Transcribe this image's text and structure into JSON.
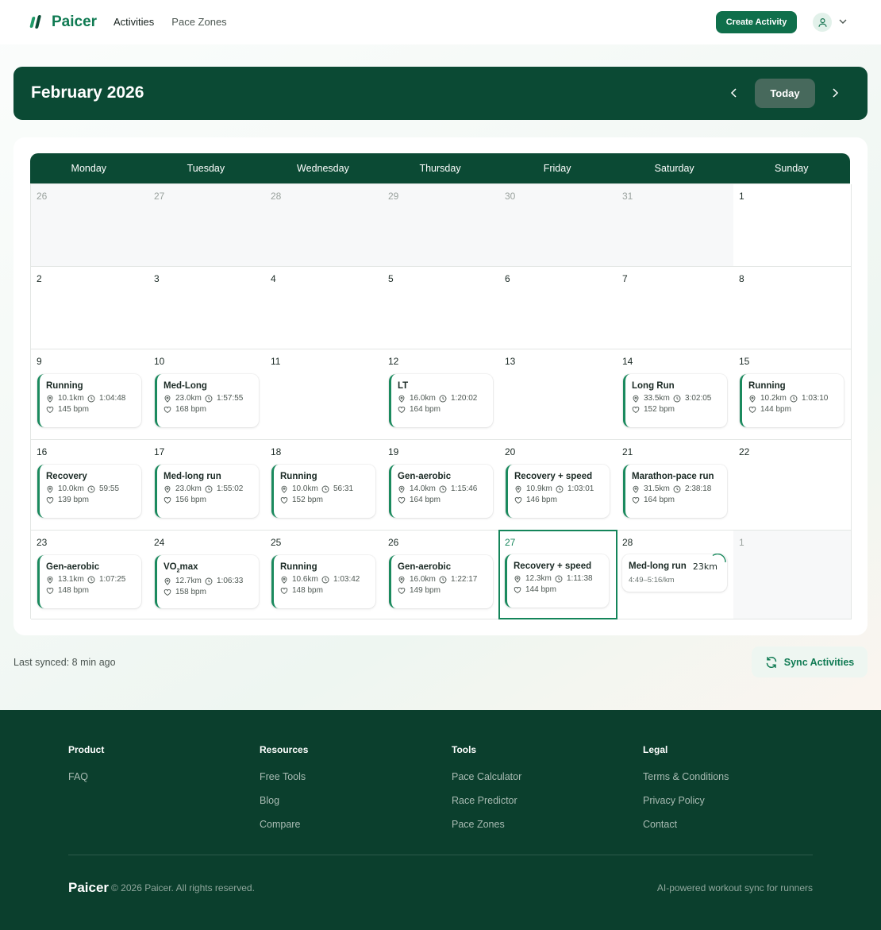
{
  "header": {
    "logo_text": "Paicer",
    "nav": [
      {
        "label": "Activities",
        "active": true
      },
      {
        "label": "Pace Zones",
        "active": false
      }
    ],
    "create_button": "Create Activity"
  },
  "calendar": {
    "month_title": "February 2026",
    "today_button": "Today",
    "weekdays": [
      "Monday",
      "Tuesday",
      "Wednesday",
      "Thursday",
      "Friday",
      "Saturday",
      "Sunday"
    ],
    "weeks": [
      [
        {
          "day": "26",
          "other": true
        },
        {
          "day": "27",
          "other": true
        },
        {
          "day": "28",
          "other": true
        },
        {
          "day": "29",
          "other": true
        },
        {
          "day": "30",
          "other": true
        },
        {
          "day": "31",
          "other": true
        },
        {
          "day": "1"
        }
      ],
      [
        {
          "day": "2"
        },
        {
          "day": "3"
        },
        {
          "day": "4"
        },
        {
          "day": "5"
        },
        {
          "day": "6"
        },
        {
          "day": "7"
        },
        {
          "day": "8"
        }
      ],
      [
        {
          "day": "9",
          "activity": {
            "title": "Running",
            "distance": "10.1km",
            "duration": "1:04:48",
            "hr": "145 bpm"
          }
        },
        {
          "day": "10",
          "activity": {
            "title": "Med-Long",
            "distance": "23.0km",
            "duration": "1:57:55",
            "hr": "168 bpm"
          }
        },
        {
          "day": "11"
        },
        {
          "day": "12",
          "activity": {
            "title": "LT",
            "distance": "16.0km",
            "duration": "1:20:02",
            "hr": "164 bpm"
          }
        },
        {
          "day": "13"
        },
        {
          "day": "14",
          "activity": {
            "title": "Long Run",
            "distance": "33.5km",
            "duration": "3:02:05",
            "hr": "152 bpm"
          }
        },
        {
          "day": "15",
          "activity": {
            "title": "Running",
            "distance": "10.2km",
            "duration": "1:03:10",
            "hr": "144 bpm"
          }
        }
      ],
      [
        {
          "day": "16",
          "activity": {
            "title": "Recovery",
            "distance": "10.0km",
            "duration": "59:55",
            "hr": "139 bpm"
          }
        },
        {
          "day": "17",
          "activity": {
            "title": "Med-long run",
            "distance": "23.0km",
            "duration": "1:55:02",
            "hr": "156 bpm"
          }
        },
        {
          "day": "18",
          "activity": {
            "title": "Running",
            "distance": "10.0km",
            "duration": "56:31",
            "hr": "152 bpm"
          }
        },
        {
          "day": "19",
          "activity": {
            "title": "Gen-aerobic",
            "distance": "14.0km",
            "duration": "1:15:46",
            "hr": "164 bpm"
          }
        },
        {
          "day": "20",
          "activity": {
            "title": "Recovery + speed",
            "distance": "10.9km",
            "duration": "1:03:01",
            "hr": "146 bpm"
          }
        },
        {
          "day": "21",
          "activity": {
            "title": "Marathon-pace run",
            "distance": "31.5km",
            "duration": "2:38:18",
            "hr": "164 bpm"
          }
        },
        {
          "day": "22"
        }
      ],
      [
        {
          "day": "23",
          "activity": {
            "title": "Gen-aerobic",
            "distance": "13.1km",
            "duration": "1:07:25",
            "hr": "148 bpm"
          }
        },
        {
          "day": "24",
          "activity": {
            "title": "VO",
            "title_sub": "2",
            "title_suffix": "max",
            "distance": "12.7km",
            "duration": "1:06:33",
            "hr": "158 bpm"
          }
        },
        {
          "day": "25",
          "activity": {
            "title": "Running",
            "distance": "10.6km",
            "duration": "1:03:42",
            "hr": "148 bpm"
          }
        },
        {
          "day": "26",
          "activity": {
            "title": "Gen-aerobic",
            "distance": "16.0km",
            "duration": "1:22:17",
            "hr": "149 bpm"
          }
        },
        {
          "day": "27",
          "today": true,
          "activity": {
            "title": "Recovery + speed",
            "distance": "12.3km",
            "duration": "1:11:38",
            "hr": "144 bpm"
          }
        },
        {
          "day": "28",
          "planned": {
            "title": "Med-long run",
            "distance": "23km",
            "pace": "4:49–5:16/km"
          }
        },
        {
          "day": "1",
          "other": true
        }
      ]
    ]
  },
  "sync": {
    "last_synced": "Last synced: 8 min ago",
    "button": "Sync Activities"
  },
  "footer": {
    "columns": [
      {
        "title": "Product",
        "links": [
          "FAQ"
        ]
      },
      {
        "title": "Resources",
        "links": [
          "Free Tools",
          "Blog",
          "Compare"
        ]
      },
      {
        "title": "Tools",
        "links": [
          "Pace Calculator",
          "Race Predictor",
          "Pace Zones"
        ]
      },
      {
        "title": "Legal",
        "links": [
          "Terms & Conditions",
          "Privacy Policy",
          "Contact"
        ]
      }
    ],
    "brand": "Paicer",
    "copyright": "© 2026 Paicer. All rights reserved.",
    "tagline": "AI-powered workout sync for runners"
  },
  "colors": {
    "brand_dark": "#0b4a34",
    "brand_accent": "#14855a",
    "footer_bg": "#0b3f2d"
  }
}
